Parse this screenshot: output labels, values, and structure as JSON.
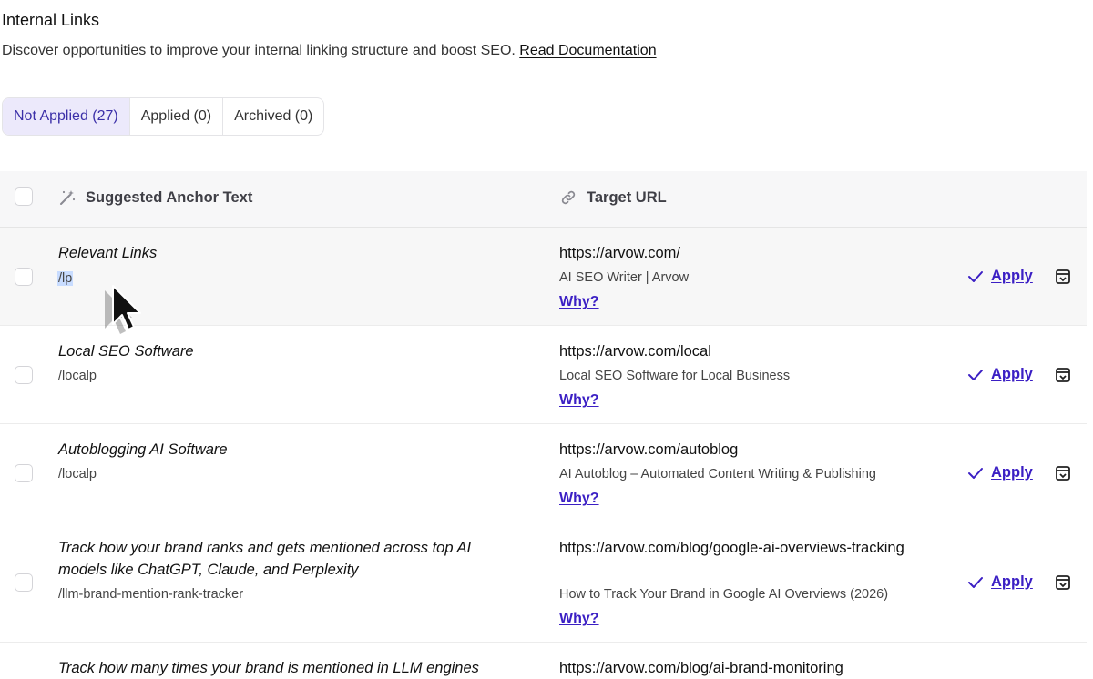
{
  "header": {
    "title": "Internal Links",
    "subtitle": "Discover opportunities to improve your internal linking structure and boost SEO.",
    "doc_link": "Read Documentation"
  },
  "tabs": [
    {
      "label": "Not Applied (27)",
      "active": true
    },
    {
      "label": "Applied (0)",
      "active": false
    },
    {
      "label": "Archived (0)",
      "active": false
    }
  ],
  "table": {
    "col_anchor": "Suggested Anchor Text",
    "col_url": "Target URL",
    "apply_label": "Apply",
    "why_label": "Why?",
    "rows": [
      {
        "anchor": "Relevant Links",
        "slug": "/lp",
        "url": "https://arvow.com/",
        "page": "AI SEO Writer | Arvow"
      },
      {
        "anchor": "Local SEO Software",
        "slug": "/localp",
        "url": "https://arvow.com/local",
        "page": "Local SEO Software for Local Business"
      },
      {
        "anchor": "Autoblogging AI Software",
        "slug": "/localp",
        "url": "https://arvow.com/autoblog",
        "page": "AI Autoblog – Automated Content Writing & Publishing"
      },
      {
        "anchor": "Track how your brand ranks and gets mentioned across top AI models like ChatGPT, Claude, and Perplexity",
        "slug": "/llm-brand-mention-rank-tracker",
        "url": "https://arvow.com/blog/google-ai-overviews-tracking",
        "page": "How to Track Your Brand in Google AI Overviews (2026)"
      },
      {
        "anchor": "Track how many times your brand is mentioned in LLM engines",
        "url": "https://arvow.com/blog/ai-brand-monitoring"
      }
    ]
  },
  "colors": {
    "accent": "#3b1fc4",
    "active_tab_bg": "#ece9fb",
    "header_bg": "#f7f7f8"
  },
  "icons": {
    "anchor_col": "magic-wand-icon",
    "url_col": "link-icon",
    "apply": "check-icon",
    "archive": "archive-icon",
    "pointer": "mouse-cursor-icon"
  }
}
